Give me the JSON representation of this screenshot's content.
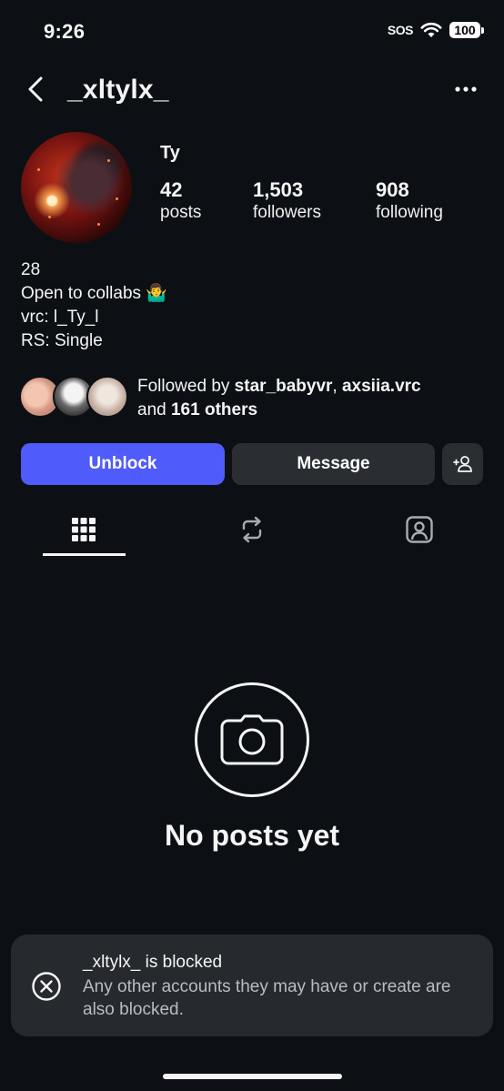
{
  "status_bar": {
    "time": "9:26",
    "sos": "SOS",
    "battery": "100",
    "icons": [
      "wifi-icon",
      "battery-icon"
    ]
  },
  "header": {
    "username": "_xltylx_",
    "back_icon": "chevron-left-icon",
    "more_icon": "more-horizontal-icon"
  },
  "profile": {
    "display_name": "Ty",
    "stats": [
      {
        "value": "42",
        "label": "posts"
      },
      {
        "value": "1,503",
        "label": "followers"
      },
      {
        "value": "908",
        "label": "following"
      }
    ],
    "bio": [
      "28",
      "Open to collabs 🤷‍♂️",
      "vrc: l_Ty_l",
      "RS: Single"
    ]
  },
  "followed_by": {
    "prefix": "Followed by ",
    "user1": "star_babyvr",
    "sep": ", ",
    "user2": "axsiia.vrc",
    "and": "and ",
    "others": "161 others"
  },
  "actions": {
    "unblock": "Unblock",
    "message": "Message",
    "add_user_icon": "add-person-icon"
  },
  "tabs": [
    {
      "icon": "grid-icon",
      "active": true
    },
    {
      "icon": "reposts-icon",
      "active": false
    },
    {
      "icon": "tagged-icon",
      "active": false
    }
  ],
  "empty_state": {
    "icon": "camera-icon",
    "title": "No posts yet"
  },
  "toast": {
    "icon": "close-circle-icon",
    "title": "_xltylx_ is blocked",
    "message": "Any other accounts they may have or create are also blocked."
  },
  "colors": {
    "background": "#0c1014",
    "primary_button": "#4f5bfa",
    "secondary_button": "#2a2e33",
    "toast_bg": "#262a2f"
  }
}
